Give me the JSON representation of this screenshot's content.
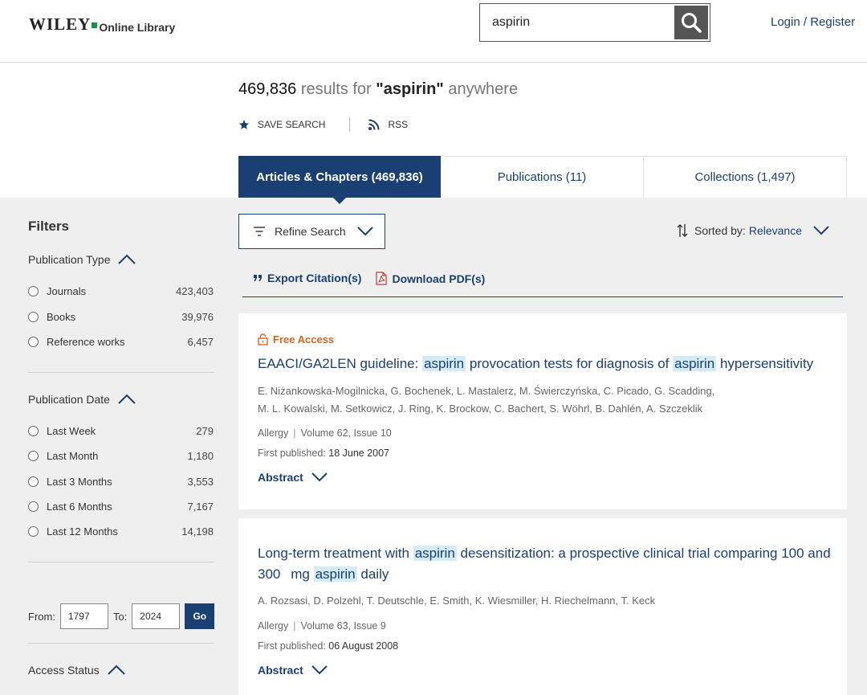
{
  "header": {
    "logo_wiley": "WILEY",
    "logo_online_library": "Online Library",
    "search_value": "aspirin",
    "login_label": "Login / Register"
  },
  "summary": {
    "count": "469,836",
    "results_for": "results for",
    "query": "\"aspirin\"",
    "anywhere": "anywhere",
    "save_search_label": "SAVE SEARCH",
    "rss_label": "RSS"
  },
  "tabs": [
    {
      "label": "Articles & Chapters (469,836)",
      "active": true
    },
    {
      "label": "Publications (11)",
      "active": false
    },
    {
      "label": "Collections (1,497)",
      "active": false
    }
  ],
  "filters": {
    "title": "Filters",
    "publication_type": {
      "title": "Publication Type",
      "items": [
        {
          "label": "Journals",
          "count": "423,403"
        },
        {
          "label": "Books",
          "count": "39,976"
        },
        {
          "label": "Reference works",
          "count": "6,457"
        }
      ]
    },
    "publication_date": {
      "title": "Publication Date",
      "items": [
        {
          "label": "Last Week",
          "count": "279"
        },
        {
          "label": "Last Month",
          "count": "1,180"
        },
        {
          "label": "Last 3 Months",
          "count": "3,553"
        },
        {
          "label": "Last 6 Months",
          "count": "7,167"
        },
        {
          "label": "Last 12 Months",
          "count": "14,198"
        }
      ]
    },
    "date_range": {
      "from_label": "From:",
      "from_value": "1797",
      "to_label": "To:",
      "to_value": "2024",
      "go_label": "Go"
    },
    "access_status": {
      "title": "Access Status"
    }
  },
  "controls": {
    "refine_label": "Refine Search",
    "sorted_by_label": "Sorted by:",
    "sorted_by_value": "Relevance",
    "export_label": "Export Citation(s)",
    "download_label": "Download PDF(s)"
  },
  "results": [
    {
      "access": "Free Access",
      "title_parts": [
        "EAACI/GA2LEN guideline: ",
        "aspirin",
        " provocation tests for diagnosis of ",
        "aspirin",
        " hypersensitivity"
      ],
      "authors_line1": "E. Niżankowska-Mogilnicka, G. Bochenek, L. Mastalerz, M. Świerczyńska, C. Picado, G. Scadding,",
      "authors_line2": "M. L. Kowalski, M. Setkowicz, J. Ring, K. Brockow, C. Bachert, S. Wöhrl, B. Dahlén, A. Szczeklik",
      "journal": "Allergy",
      "volume": "Volume 62, Issue 10",
      "first_published_label": "First published:",
      "first_published": "18 June 2007",
      "abstract_label": "Abstract"
    },
    {
      "title_parts": [
        "Long-term treatment with ",
        "aspirin",
        " desensitization: a prospective clinical trial comparing 100 and 300   mg ",
        "aspirin",
        " daily"
      ],
      "authors": "A. Rozsasi, D. Polzehl, T. Deutschle, E. Smith, K. Wiesmiller, H. Riechelmann, T. Keck",
      "journal": "Allergy",
      "volume": "Volume 63, Issue 9",
      "first_published_label": "First published:",
      "first_published": "06 August 2008",
      "abstract_label": "Abstract"
    }
  ]
}
